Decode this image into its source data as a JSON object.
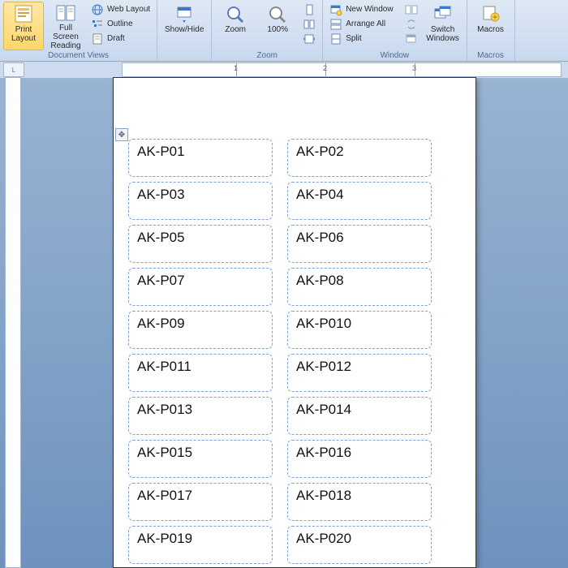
{
  "ribbon": {
    "groups": {
      "views": {
        "label": "Document Views",
        "print_layout": "Print\nLayout",
        "full_screen": "Full Screen\nReading",
        "web_layout": "Web Layout",
        "outline": "Outline",
        "draft": "Draft"
      },
      "zoom": {
        "label": "Zoom",
        "showhide": "Show/Hide",
        "zoom": "Zoom",
        "pct100": "100%"
      },
      "window": {
        "label": "Window",
        "neww": "New Window",
        "arrange": "Arrange All",
        "split": "Split",
        "switch": "Switch\nWindows"
      },
      "macros": {
        "label": "Macros",
        "macros": "Macros"
      }
    }
  },
  "ruler": {
    "corner": "L",
    "marks": [
      "1",
      "2",
      "3"
    ]
  },
  "labels": {
    "prefix": "AK-P0",
    "col1": [
      "1",
      "3",
      "5",
      "7",
      "9",
      "11",
      "13",
      "15",
      "17",
      "19"
    ],
    "col2": [
      "2",
      "4",
      "6",
      "8",
      "10",
      "12",
      "14",
      "16",
      "18",
      "20"
    ]
  }
}
